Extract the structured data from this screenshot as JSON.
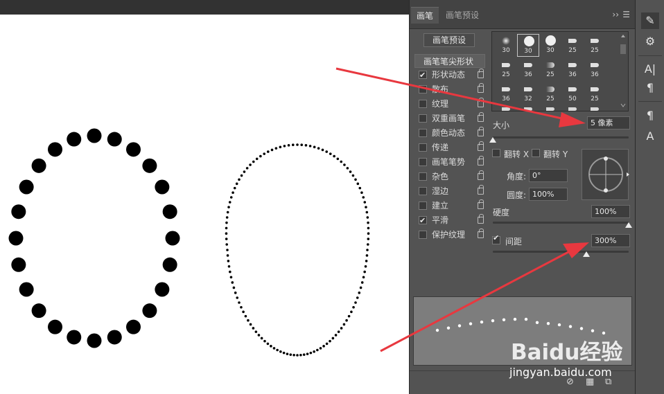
{
  "panel": {
    "tabs": [
      {
        "label": "画笔",
        "active": true
      },
      {
        "label": "画笔预设",
        "active": false
      }
    ],
    "collapse_icon": "double-chevron-right-icon",
    "menu_icon": "panel-menu-icon",
    "preset_button": "画笔预设",
    "section_header": "画笔笔尖形状",
    "sections": [
      {
        "label": "形状动态",
        "checked": true
      },
      {
        "label": "散布",
        "checked": false
      },
      {
        "label": "纹理",
        "checked": false
      },
      {
        "label": "双重画笔",
        "checked": false
      },
      {
        "label": "颜色动态",
        "checked": false
      },
      {
        "label": "传递",
        "checked": false
      },
      {
        "label": "画笔笔势",
        "checked": false
      },
      {
        "label": "杂色",
        "checked": false
      },
      {
        "label": "湿边",
        "checked": false
      },
      {
        "label": "建立",
        "checked": false
      },
      {
        "label": "平滑",
        "checked": true
      },
      {
        "label": "保护纹理",
        "checked": false
      }
    ],
    "brush_tips": [
      [
        "30",
        "30",
        "30",
        "25",
        "25"
      ],
      [
        "25",
        "36",
        "25",
        "36",
        "36"
      ],
      [
        "36",
        "32",
        "25",
        "50",
        "25"
      ]
    ],
    "selected_tip": "30",
    "size_label": "大小",
    "size_value": "5 像素",
    "flip_x": "翻转 X",
    "flip_y": "翻转 Y",
    "angle_label": "角度:",
    "angle_value": "0°",
    "roundness_label": "圆度:",
    "roundness_value": "100%",
    "hardness_label": "硬度",
    "hardness_value": "100%",
    "hardness_level": 1.0,
    "spacing_label": "间距",
    "spacing_checked": true,
    "spacing_value": "300%",
    "spacing_level": 0.69,
    "size_level": 0.0
  },
  "toolstrip": {
    "tools": [
      "brush-panel-icon",
      "brush-settings-icon",
      "character-icon",
      "paragraph-icon",
      "paragraph-styles-icon",
      "character-styles-icon"
    ],
    "glyphs": [
      "✎",
      "⚙",
      "A|",
      "¶",
      "¶",
      "A"
    ]
  },
  "bottom_bar": {
    "icons": [
      "new-preset-icon",
      "grid-icon",
      "delete-icon"
    ]
  },
  "watermark": {
    "logo": "Baidu经验",
    "url": "jingyan.baidu.com"
  },
  "colors": {
    "panel_bg": "#535353",
    "arrow": "#e8383f"
  }
}
